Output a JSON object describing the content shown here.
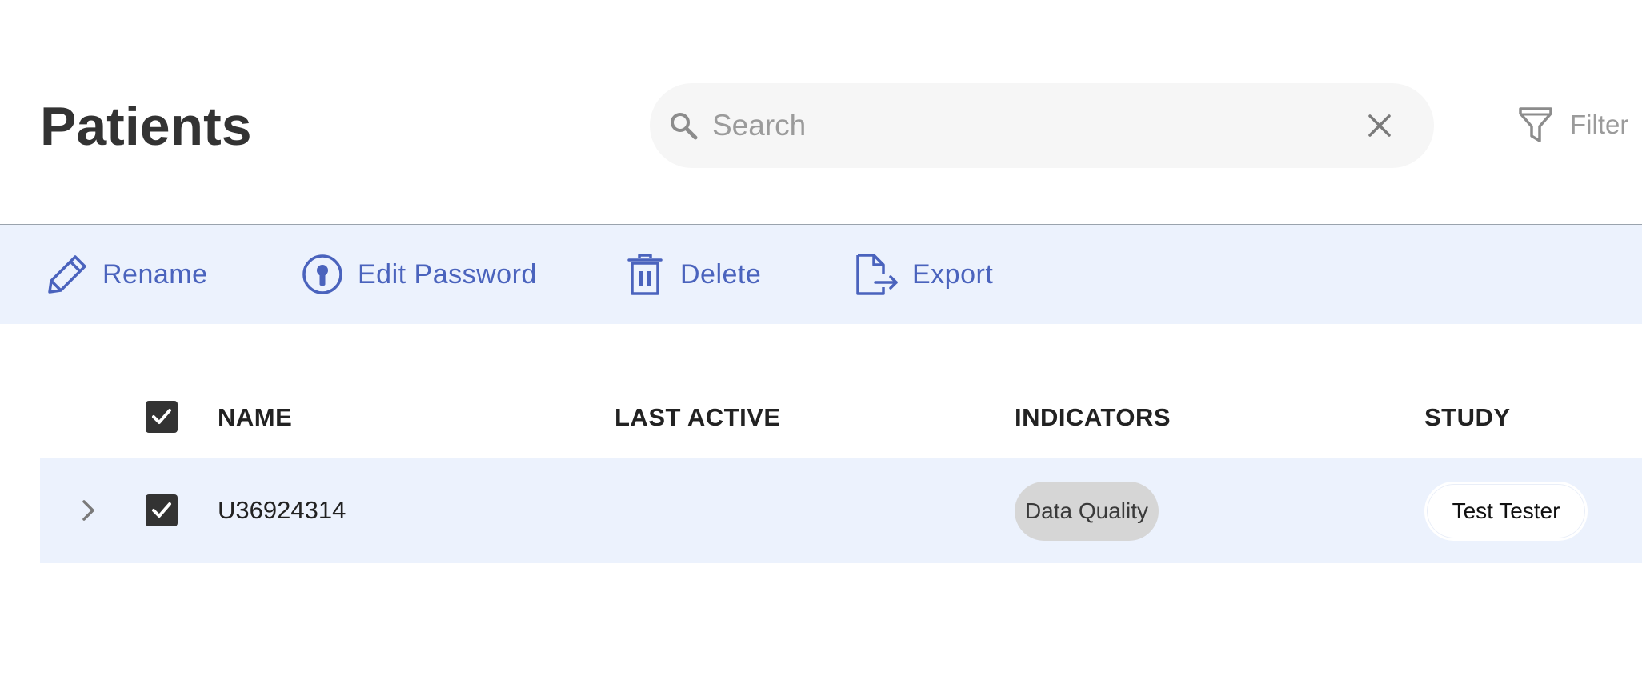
{
  "header": {
    "title": "Patients",
    "search_placeholder": "Search",
    "search_value": "",
    "filter_label": "Filter"
  },
  "toolbar": {
    "rename_label": "Rename",
    "edit_password_label": "Edit Password",
    "delete_label": "Delete",
    "export_label": "Export"
  },
  "table": {
    "columns": {
      "name": "NAME",
      "last_active": "LAST ACTIVE",
      "indicators": "INDICATORS",
      "study": "STUDY"
    },
    "select_all_checked": true,
    "rows": [
      {
        "name": "U36924314",
        "last_active": "",
        "indicator": "Data Quality",
        "study": "Test Tester",
        "checked": true
      }
    ]
  },
  "colors": {
    "accent": "#4a63bd",
    "toolbar_bg": "#ecf2fd",
    "checkbox": "#333333",
    "badge_bg": "#d6d6d6"
  },
  "icons": {
    "search": "search-icon",
    "clear": "close-icon",
    "filter": "funnel-icon",
    "rename": "pencil-icon",
    "edit_password": "keyhole-icon",
    "delete": "trash-icon",
    "export": "file-export-icon",
    "expand": "chevron-right-icon",
    "check": "checkmark-icon"
  }
}
